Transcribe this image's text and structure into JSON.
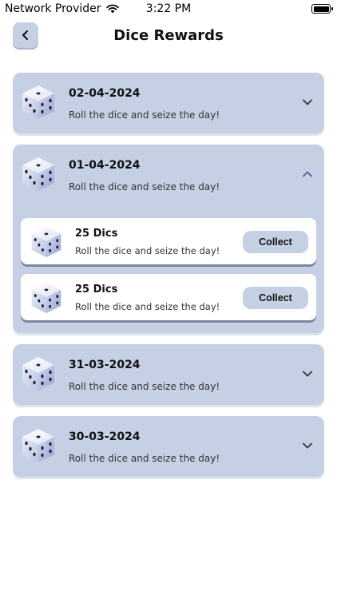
{
  "status_bar": {
    "carrier": "Network Provider",
    "time": "3:22 PM"
  },
  "header": {
    "title": "Dice Rewards"
  },
  "cards": [
    {
      "date": "02-04-2024",
      "subtitle": "Roll the dice and seize the day!",
      "expanded": false
    },
    {
      "date": "01-04-2024",
      "subtitle": "Roll the dice and seize the day!",
      "expanded": true,
      "rewards": [
        {
          "title": "25 Dics",
          "subtitle": "Roll the dice and seize the day!",
          "button": "Collect"
        },
        {
          "title": "25 Dics",
          "subtitle": "Roll the dice and seize the day!",
          "button": "Collect"
        }
      ]
    },
    {
      "date": "31-03-2024",
      "subtitle": "Roll the dice and seize the day!",
      "expanded": false
    },
    {
      "date": "30-03-2024",
      "subtitle": "Roll the dice and seize the day!",
      "expanded": false
    }
  ],
  "colors": {
    "card_bg": "#c5d0e4",
    "accent": "#5b5a9a"
  }
}
